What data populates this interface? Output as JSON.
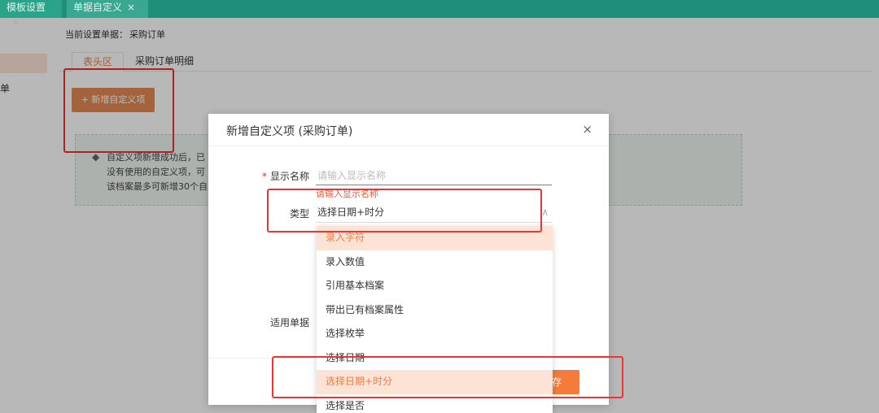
{
  "tabs": [
    {
      "label": "模板设置",
      "close": "×"
    },
    {
      "label": "单据自定义",
      "close": "×"
    }
  ],
  "sidebar": {
    "label": "单"
  },
  "context": {
    "label": "当前设置单据：",
    "value": "采购订单"
  },
  "subtabs": [
    {
      "label": "表头区"
    },
    {
      "label": "采购订单明细"
    }
  ],
  "add_button": {
    "icon": "+",
    "label": "新增自定义项"
  },
  "notice": {
    "icon": "◆",
    "lines": [
      "自定义项新增成功后，已",
      "没有使用的自定义项，可",
      "该档案最多可新增30个自"
    ]
  },
  "dialog": {
    "title": "新增自定义项 (采购订单)",
    "close": "×",
    "name_label": "显示名称",
    "required_mark": "*",
    "name_placeholder": "请输入显示名称",
    "name_error": "请输入显示名称",
    "type_label": "类型",
    "type_value": "选择日期+时分",
    "type_chevron": "∧",
    "scope_label": "适用单据",
    "save_label": "存"
  },
  "dropdown": {
    "options": [
      "录入字符",
      "录入数值",
      "引用基本档案",
      "带出已有档案属性",
      "选择枚举",
      "选择日期",
      "选择日期+时分",
      "选择是否"
    ],
    "selected": "选择日期+时分"
  },
  "colors": {
    "accent": "#f47c3c",
    "header": "#1f8f7a",
    "annotation": "#e33333"
  }
}
